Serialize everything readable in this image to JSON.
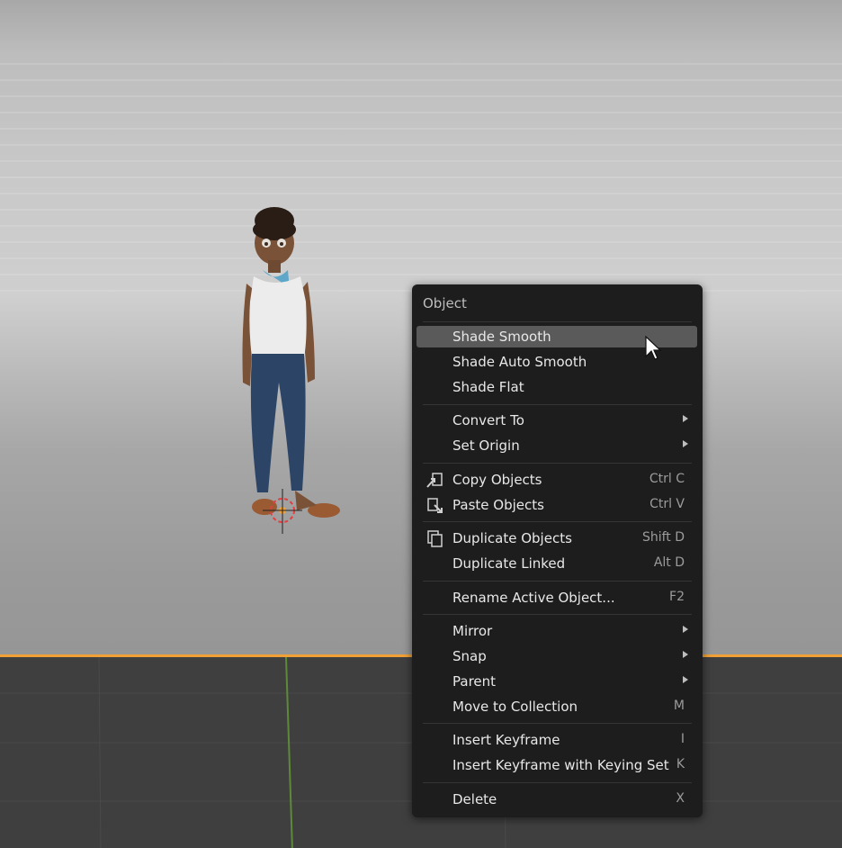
{
  "menu": {
    "title": "Object",
    "items": [
      {
        "label": "Shade Smooth",
        "underline": "S",
        "shortcut": "",
        "submenu": false,
        "highlighted": true,
        "icon": ""
      },
      {
        "label": "Shade Auto Smooth",
        "underline": "A",
        "shortcut": "",
        "submenu": false,
        "highlighted": false,
        "icon": ""
      },
      {
        "label": "Shade Flat",
        "underline": "F",
        "shortcut": "",
        "submenu": false,
        "highlighted": false,
        "icon": ""
      },
      {
        "label": "Convert To",
        "underline": "C",
        "shortcut": "",
        "submenu": true,
        "highlighted": false,
        "icon": ""
      },
      {
        "label": "Set Origin",
        "underline": "O",
        "shortcut": "",
        "submenu": true,
        "highlighted": false,
        "icon": ""
      },
      {
        "label": "Copy Objects",
        "underline": "y",
        "shortcut": "Ctrl C",
        "submenu": false,
        "highlighted": false,
        "icon": "copy-objects-icon"
      },
      {
        "label": "Paste Objects",
        "underline": "P",
        "shortcut": "Ctrl V",
        "submenu": false,
        "highlighted": false,
        "icon": "paste-objects-icon"
      },
      {
        "label": "Duplicate Objects",
        "underline": "D",
        "shortcut": "Shift D",
        "submenu": false,
        "highlighted": false,
        "icon": "duplicate-icon"
      },
      {
        "label": "Duplicate Linked",
        "underline": "L",
        "shortcut": "Alt D",
        "submenu": false,
        "highlighted": false,
        "icon": ""
      },
      {
        "label": "Rename Active Object...",
        "underline": "R",
        "shortcut": "F2",
        "submenu": false,
        "highlighted": false,
        "icon": ""
      },
      {
        "label": "Mirror",
        "underline": "M",
        "shortcut": "",
        "submenu": true,
        "highlighted": false,
        "icon": ""
      },
      {
        "label": "Snap",
        "underline": "n",
        "shortcut": "",
        "submenu": true,
        "highlighted": false,
        "icon": ""
      },
      {
        "label": "Parent",
        "underline": "r",
        "shortcut": "",
        "submenu": true,
        "highlighted": false,
        "icon": ""
      },
      {
        "label": "Move to Collection",
        "underline": "t",
        "shortcut": "M",
        "submenu": false,
        "highlighted": false,
        "icon": ""
      },
      {
        "label": "Insert Keyframe",
        "underline": "I",
        "shortcut": "I",
        "submenu": false,
        "highlighted": false,
        "icon": ""
      },
      {
        "label": "Insert Keyframe with Keying Set",
        "underline": "K",
        "shortcut": "K",
        "submenu": false,
        "highlighted": false,
        "icon": ""
      },
      {
        "label": "Delete",
        "underline": "",
        "shortcut": "X",
        "submenu": false,
        "highlighted": false,
        "icon": ""
      }
    ]
  },
  "colors": {
    "menu_bg": "#1d1d1d",
    "highlight": "#5a5a5a",
    "floor_edge": "#f0a035",
    "floor": "#3f3f3f"
  }
}
